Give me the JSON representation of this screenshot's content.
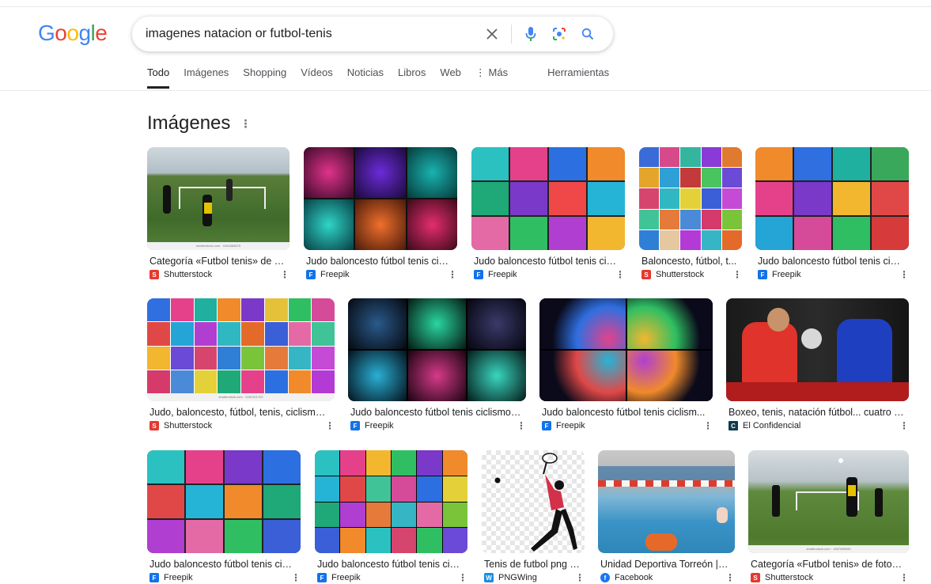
{
  "logo": [
    "G",
    "o",
    "o",
    "g",
    "l",
    "e"
  ],
  "search": {
    "query": "imagenes natacion or futbol-tenis"
  },
  "icons": {
    "clear": "close-icon",
    "mic": "mic-icon",
    "lens": "lens-icon",
    "search": "search-icon"
  },
  "tabs": [
    "Todo",
    "Imágenes",
    "Shopping",
    "Vídeos",
    "Noticias",
    "Libros",
    "Web",
    "⋮ Más",
    "Herramientas"
  ],
  "section": {
    "title": "Imágenes"
  },
  "images": [
    {
      "caption": "Categoría «Futbol tenis» de f...",
      "source": "Shutterstock",
      "fav": "S"
    },
    {
      "caption": "Judo baloncesto fútbol tenis cicl...",
      "source": "Freepik",
      "fav": "F"
    },
    {
      "caption": "Judo baloncesto fútbol tenis cicl...",
      "source": "Freepik",
      "fav": "F"
    },
    {
      "caption": "Baloncesto, fútbol, t...",
      "source": "Shutterstock",
      "fav": "S"
    },
    {
      "caption": "Judo baloncesto fútbol tenis cicl...",
      "source": "Freepik",
      "fav": "F"
    },
    {
      "caption": "Judo, baloncesto, fútbol, tenis, ciclismo,...",
      "source": "Shutterstock",
      "fav": "S"
    },
    {
      "caption": "Judo baloncesto fútbol tenis ciclismo ...",
      "source": "Freepik",
      "fav": "F"
    },
    {
      "caption": "Judo baloncesto fútbol tenis ciclism...",
      "source": "Freepik",
      "fav": "F"
    },
    {
      "caption": "Boxeo, tenis, natación fútbol... cuatro c...",
      "source": "El Confidencial",
      "fav": "C"
    },
    {
      "caption": "Judo baloncesto fútbol tenis cicl...",
      "source": "Freepik",
      "fav": "F"
    },
    {
      "caption": "Judo baloncesto fútbol tenis cic...",
      "source": "Freepik",
      "fav": "F"
    },
    {
      "caption": "Tenis de futbol png i...",
      "source": "PNGWing",
      "fav": "W"
    },
    {
      "caption": "Unidad Deportiva Torreón | T...",
      "source": "Facebook",
      "fav": "f"
    },
    {
      "caption": "Categoría «Futbol tenis» de fotos ...",
      "source": "Shutterstock",
      "fav": "S"
    }
  ],
  "watermarks": [
    "shutterstock.com · 1901858575",
    "shutterstock.com · 2091321703",
    "shutterstock.com · 1837089949"
  ],
  "colors": {
    "blue": "#4285F4",
    "red": "#EA4335",
    "yellow": "#FBBC05",
    "green": "#34A853",
    "shutterstock": "#e6392f",
    "freepik": "#1273eb"
  }
}
